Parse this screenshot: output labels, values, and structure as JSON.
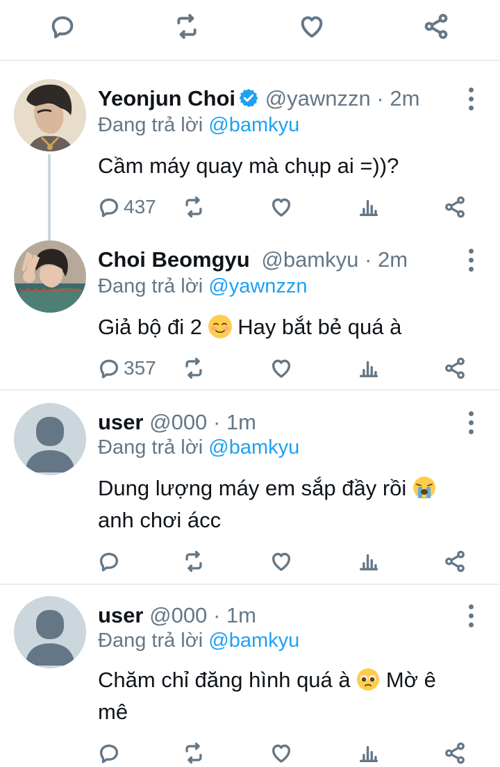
{
  "top_actions": [
    "reply-icon",
    "retweet-icon",
    "like-icon",
    "share-icon"
  ],
  "tweets": [
    {
      "name": "Yeonjun Choi",
      "verified": true,
      "handle": "@yawnzzn",
      "dot": "·",
      "time": "2m",
      "replying_prefix": "Đang trả lời",
      "replying_to": "@bamkyu",
      "text": "Cầm máy quay mà chụp ai =))?",
      "reply_count": "437"
    },
    {
      "name": "Choi Beomgyu",
      "verified": false,
      "handle": "@bamkyu",
      "dot": "·",
      "time": "2m",
      "replying_prefix": "Đang trả lời",
      "replying_to": "@yawnzzn",
      "text_before": "Giả bộ đi 2",
      "text_after": "Hay bắt bẻ quá à",
      "reply_count": "357"
    },
    {
      "name": "user",
      "verified": false,
      "handle": "@000",
      "dot": "·",
      "time": "1m",
      "replying_prefix": "Đang trả lời",
      "replying_to": "@bamkyu",
      "line1": "Dung lượng máy em sắp đầy rồi",
      "line2": "anh chơi ácc",
      "reply_count": ""
    },
    {
      "name": "user",
      "verified": false,
      "handle": "@000",
      "dot": "·",
      "time": "1m",
      "replying_prefix": "Đang trả lời",
      "replying_to": "@bamkyu",
      "line1_before": "Chăm chỉ đăng hình quá à",
      "line1_after": "Mờ ê",
      "line2": "mê",
      "reply_count": ""
    }
  ],
  "colors": {
    "accent": "#1da1f2",
    "muted": "#657786",
    "text": "#0f1419",
    "divider": "#e6ecf0",
    "placeholder_avatar_bg": "#ccd6dd",
    "placeholder_avatar_fg": "#657786"
  }
}
